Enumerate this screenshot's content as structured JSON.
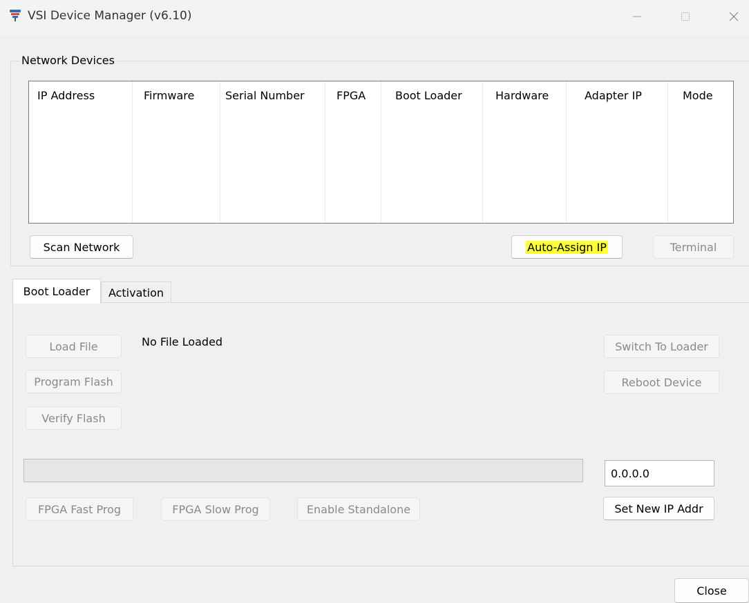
{
  "window": {
    "title": "VSI Device Manager (v6.10)",
    "icon": "vsi-app-icon"
  },
  "network_devices": {
    "group_label": "Network Devices",
    "columns": [
      "IP Address",
      "Firmware",
      "Serial Number",
      "FPGA",
      "Boot Loader",
      "Hardware",
      "Adapter IP",
      "Mode"
    ],
    "rows": [],
    "scan_button": "Scan Network",
    "auto_assign_button": "Auto-Assign IP",
    "terminal_button": "Terminal"
  },
  "tabs": [
    {
      "label": "Boot Loader",
      "active": true
    },
    {
      "label": "Activation",
      "active": false
    }
  ],
  "boot_loader": {
    "load_file_button": "Load File",
    "file_status": "No File Loaded",
    "program_flash_button": "Program Flash",
    "verify_flash_button": "Verify Flash",
    "switch_to_loader_button": "Switch To Loader",
    "reboot_device_button": "Reboot Device",
    "progress_value": 0,
    "ip_address_value": "0.0.0.0",
    "set_ip_button": "Set New IP Addr",
    "fpga_fast_button": "FPGA Fast Prog",
    "fpga_slow_button": "FPGA Slow Prog",
    "enable_standalone_button": "Enable Standalone"
  },
  "footer": {
    "close_button": "Close"
  },
  "colors": {
    "highlight": "#ffff33",
    "window_bg": "#f0f0f0"
  }
}
